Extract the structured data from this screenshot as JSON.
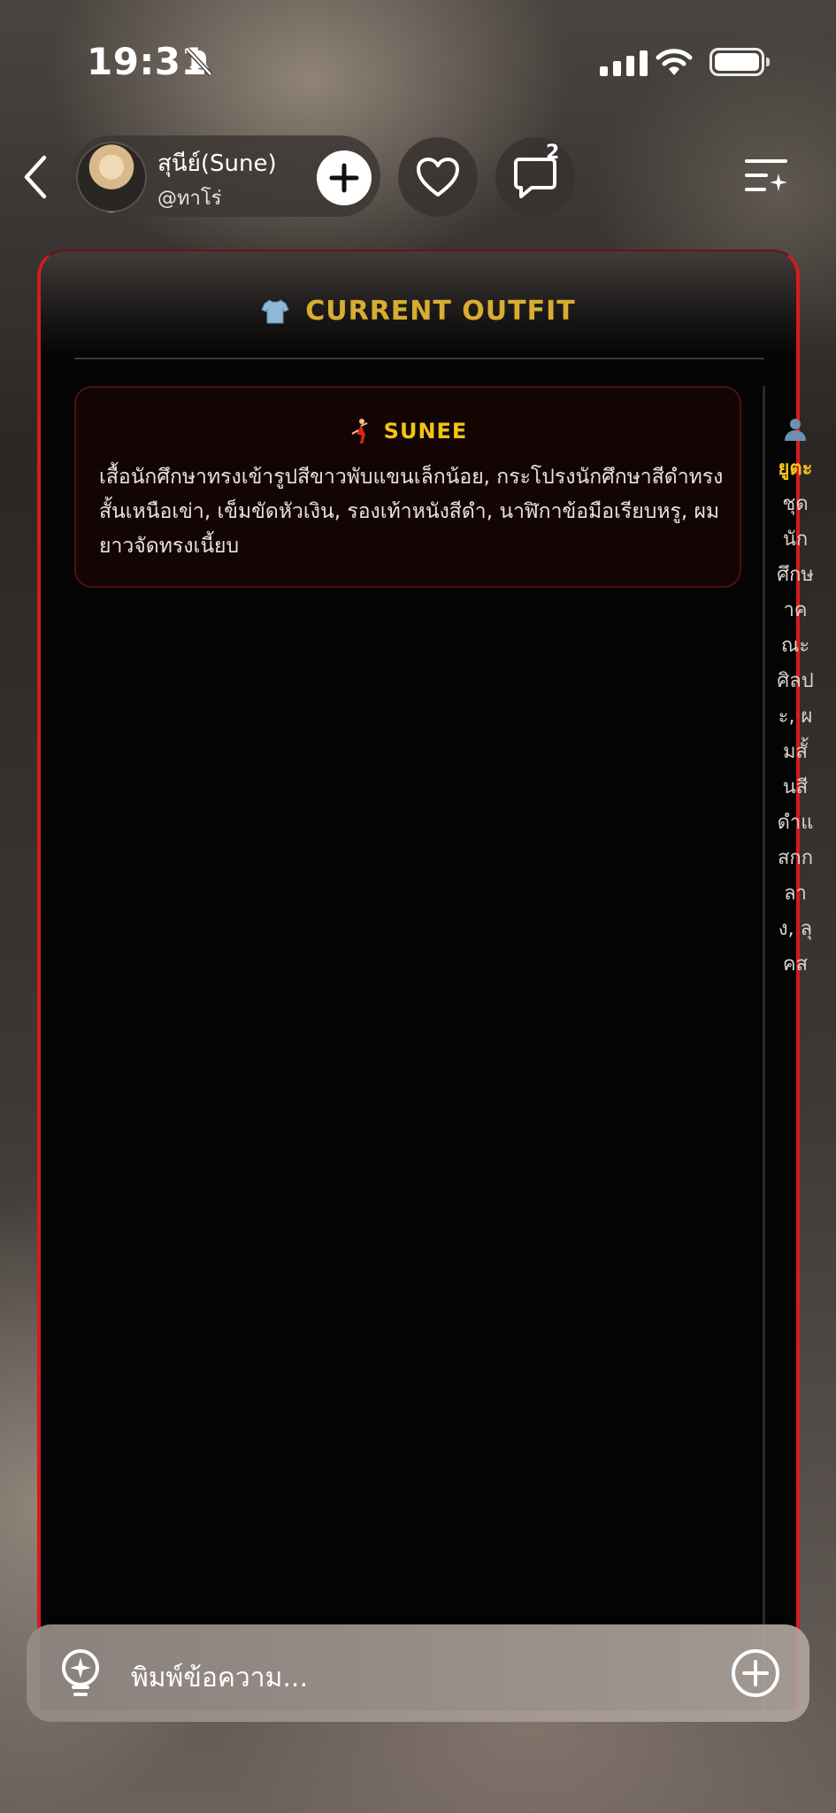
{
  "status_bar": {
    "time": "19:31",
    "icons": [
      "bell-slash-icon",
      "cellular-signal-icon",
      "wifi-icon",
      "battery-icon"
    ]
  },
  "header": {
    "profile_name": "สุนีย์(Sune)",
    "profile_handle": "@ทาโร่",
    "chat_badge": "2",
    "icons": [
      "back-chevron-icon",
      "plus-icon",
      "heart-icon",
      "chat-bubble-icon",
      "menu-sparkle-icon"
    ]
  },
  "panel": {
    "title": "CURRENT OUTFIT",
    "title_icon": "shirt-icon",
    "accent_color": "#d8ad30",
    "border_color": "#d61b1b",
    "outfit": {
      "icon": "dancer-icon",
      "name": "SUNEE",
      "description": "เสื้อนักศึกษาทรงเข้ารูปสีขาวพับแขนเล็กน้อย, กระโปรงนักศึกษาสีดำทรงสั้นเหนือเข่า, เข็มขัดหัวเงิน, รองเท้าหนังสีดำ, นาฬิกาข้อมือเรียบหรู, ผมยาวจัดทรงเนี้ยบ"
    },
    "side_column": {
      "icon": "person-icon",
      "label": "ยูตะ",
      "value": "ชุดนักศึกษาคณะศิลปะ, ผมสั้นสีดำแสกกลาง, ลุคส"
    }
  },
  "input_bar": {
    "placeholder": "พิมพ์ข้อความ...",
    "icons": [
      "lightbulb-icon",
      "plus-circle-icon"
    ]
  }
}
